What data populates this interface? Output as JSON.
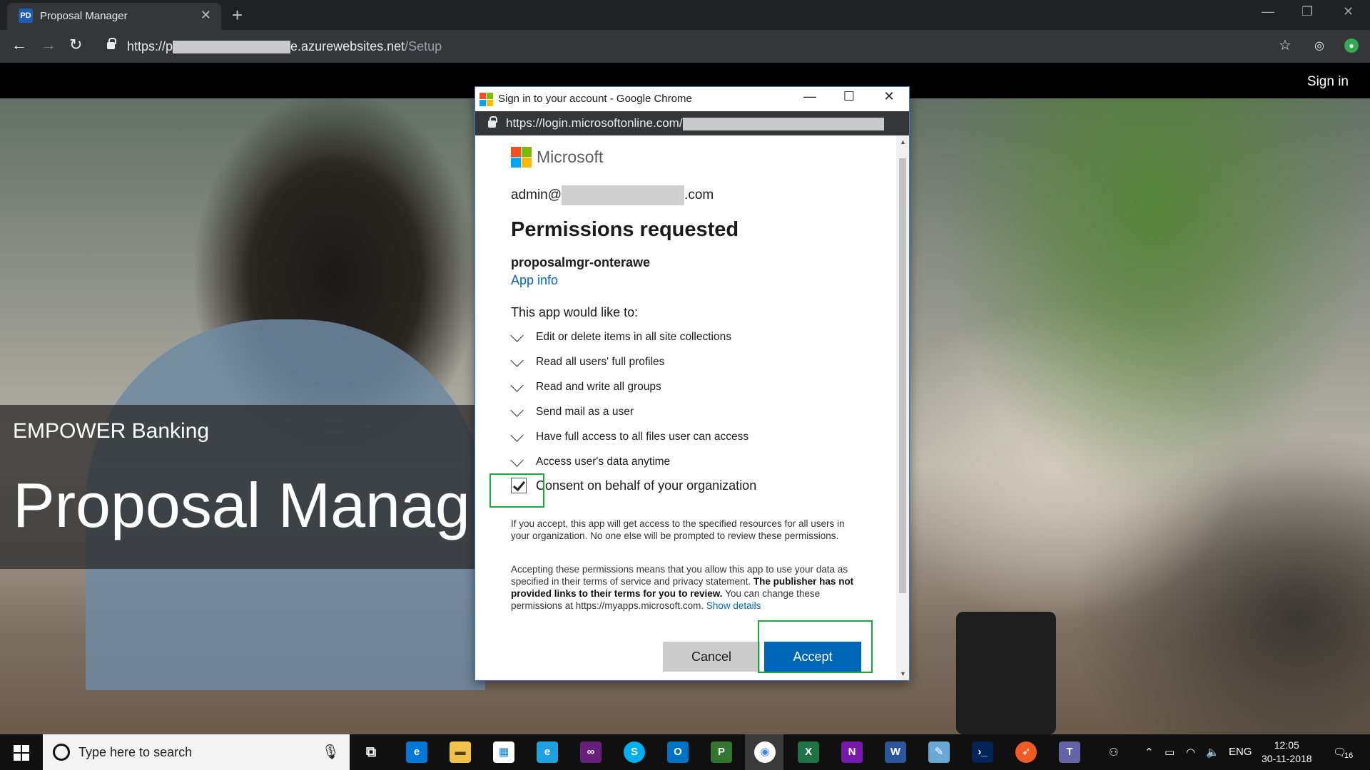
{
  "browser": {
    "tab_title": "Proposal Manager",
    "tab_favicon": "PD",
    "url_prefix": "https://p",
    "url_domain": "e.azurewebsites.net",
    "url_path": "/Setup"
  },
  "page": {
    "signin_label": "Sign in",
    "hero_subtitle": "EMPOWER Banking",
    "hero_title": "Proposal Manag"
  },
  "popup": {
    "window_title": "Sign in to your account - Google Chrome",
    "url_text": "https://login.microsoftonline.com/",
    "brand": "Microsoft",
    "account_prefix": "admin@",
    "account_suffix": ".com",
    "heading": "Permissions requested",
    "app_name": "proposalmgr-onterawe",
    "app_info_link": "App info",
    "intro": "This app would like to:",
    "permissions": [
      "Edit or delete items in all site collections",
      "Read all users' full profiles",
      "Read and write all groups",
      "Send mail as a user",
      "Have full access to all files user can access",
      "Access user's data anytime"
    ],
    "consent_label": "Consent on behalf of your organization",
    "consent_checked": true,
    "para1": "If you accept, this app will get access to the specified resources for all users in your organization. No one else will be prompted to review these permissions.",
    "para2_a": "Accepting these permissions means that you allow this app to use your data as specified in their terms of service and privacy statement.",
    "para2_bold": "The publisher has not provided links to their terms for you to review.",
    "para2_b": "You can change these permissions at https://myapps.microsoft.com.",
    "para2_link": "Show details",
    "cancel_label": "Cancel",
    "accept_label": "Accept"
  },
  "taskbar": {
    "search_placeholder": "Type here to search",
    "language": "ENG",
    "time": "12:05",
    "date": "30-11-2018",
    "notification_count": "16",
    "apps": [
      "edge-icon",
      "file-explorer-icon",
      "store-icon",
      "ie-icon",
      "visual-studio-icon",
      "skype-icon",
      "outlook-icon",
      "project-icon",
      "chrome-icon",
      "excel-icon",
      "onenote-icon",
      "word-icon",
      "paint-icon",
      "powershell-icon",
      "postman-icon",
      "teams-icon"
    ]
  },
  "colors": {
    "accent_blue": "#0067b8",
    "highlight_green": "#19a83a",
    "chrome_dark": "#35363a"
  }
}
